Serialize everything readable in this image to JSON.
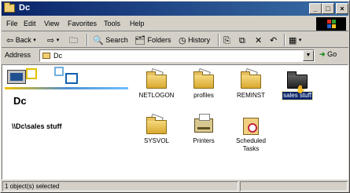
{
  "window": {
    "title": "Dc"
  },
  "menu": {
    "items": [
      "File",
      "Edit",
      "View",
      "Favorites",
      "Tools",
      "Help"
    ]
  },
  "toolbar": {
    "back": "Back",
    "search": "Search",
    "folders": "Folders",
    "history": "History"
  },
  "address": {
    "label": "Address",
    "value": "Dc",
    "go": "Go"
  },
  "left_pane": {
    "title": "Dc",
    "path": "\\\\Dc\\sales stuff"
  },
  "items": [
    {
      "label": "NETLOGON",
      "icon": "folder-icon"
    },
    {
      "label": "profiles",
      "icon": "folder-icon"
    },
    {
      "label": "REMINST",
      "icon": "folder-icon"
    },
    {
      "label": "sales stuff",
      "icon": "shared-folder-icon",
      "selected": true
    },
    {
      "label": "SYSVOL",
      "icon": "folder-icon"
    },
    {
      "label": "Printers",
      "icon": "printer-icon"
    },
    {
      "label": "Scheduled Tasks",
      "icon": "scheduled-tasks-icon"
    }
  ],
  "status": {
    "text": "1 object(s) selected"
  }
}
